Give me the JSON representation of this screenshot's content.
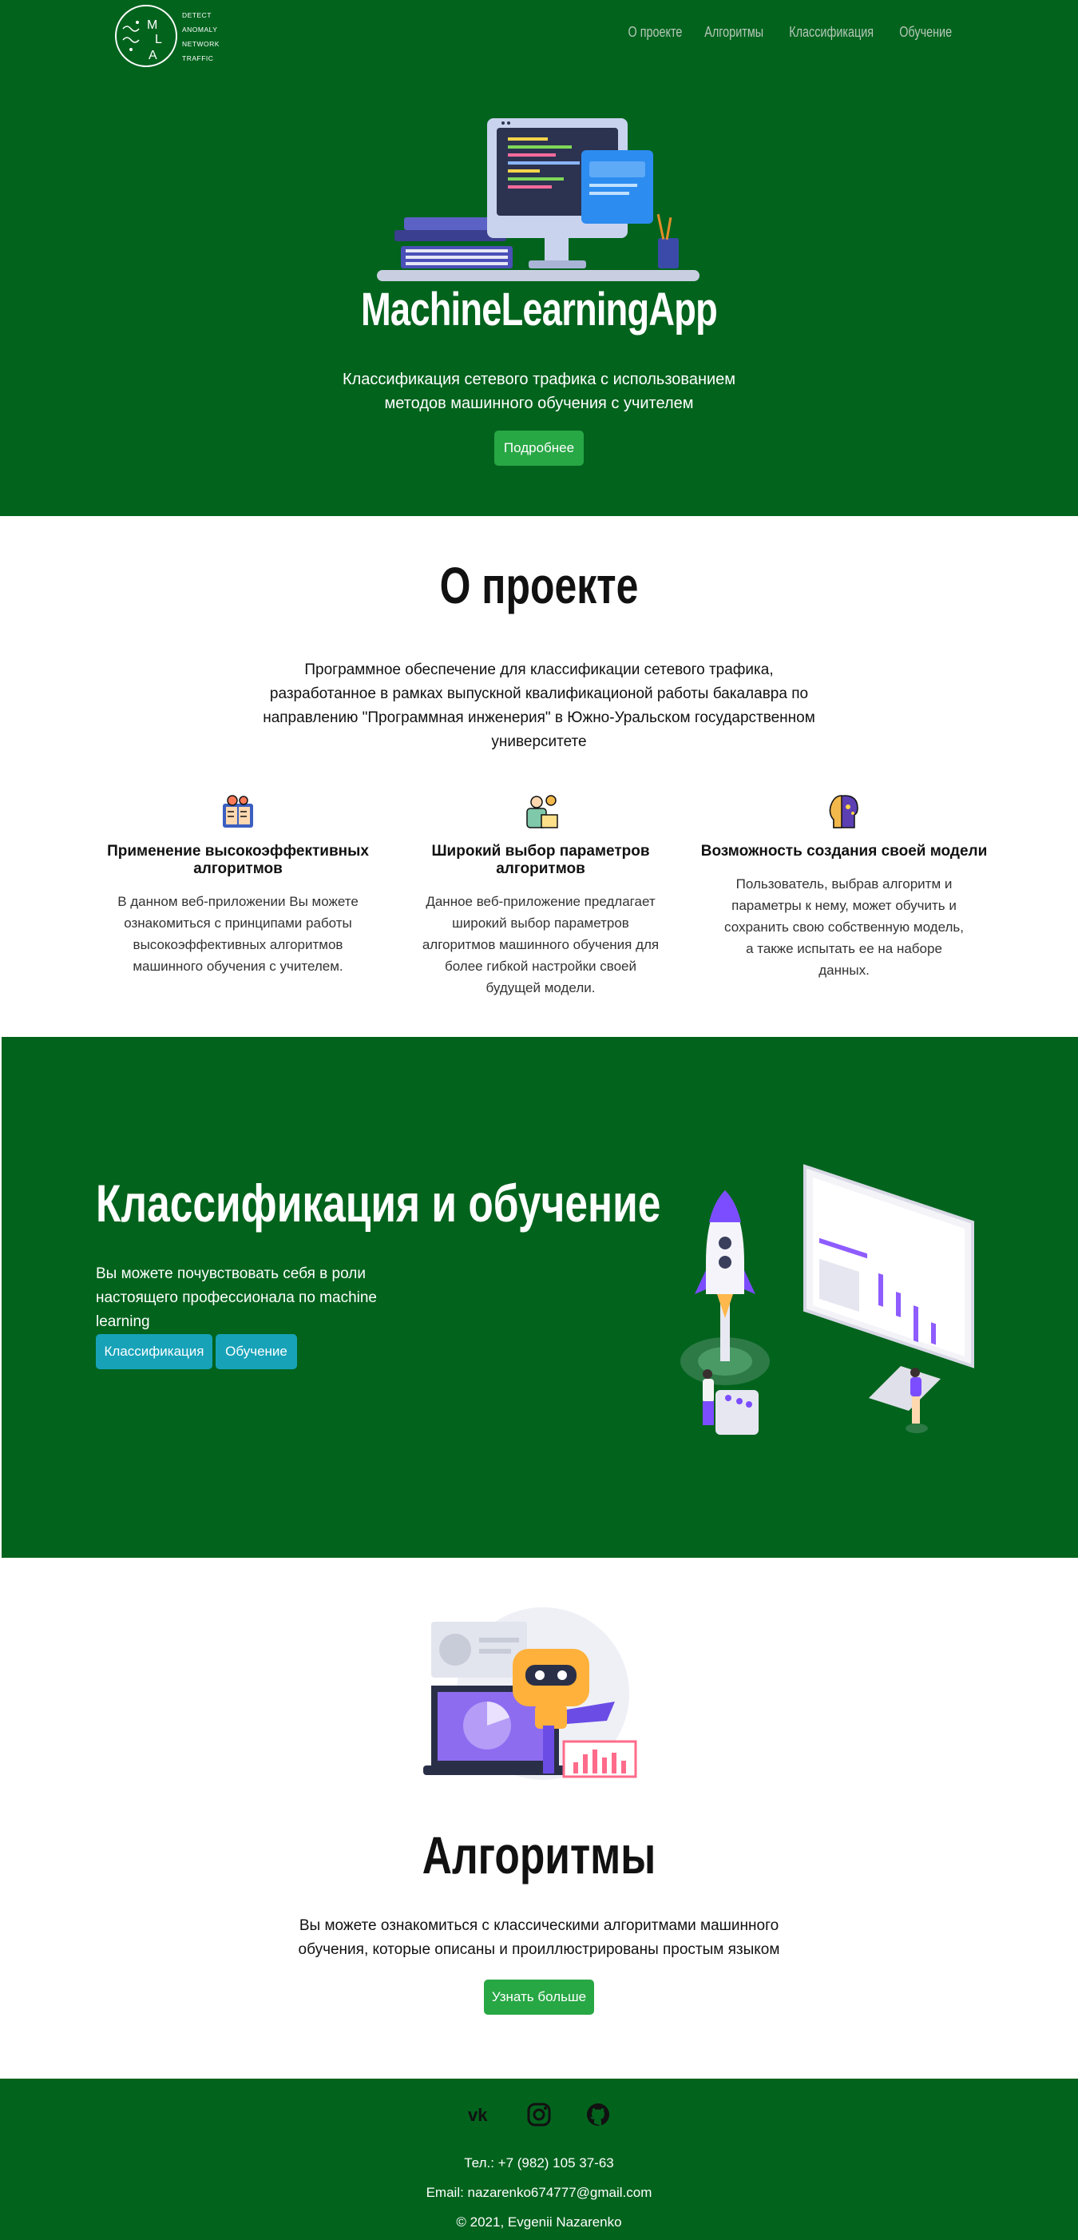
{
  "logo": {
    "letters": [
      "M",
      "L",
      "A"
    ],
    "words": [
      "DETECT",
      "ANOMALY",
      "NETWORK",
      "TRAFFIC"
    ]
  },
  "nav": {
    "items": [
      "О проекте",
      "Алгоритмы",
      "Классификация",
      "Обучение"
    ]
  },
  "hero": {
    "title": "MachineLearningApp",
    "subtitle": "Классификация сетевого трафика с использованием методов машинного обучения с учителем",
    "button": "Подробнее"
  },
  "about": {
    "title": "О проекте",
    "text": "Программное обеспечение для классификации сетевого трафика, разработанное в рамках выпускной квалификационой работы бакалавра по направлению \"Программная инженерия\" в Южно-Уральском государственном университете",
    "features": [
      {
        "icon": "book-gears-icon",
        "title": "Применение высокоэффективных алгоритмов",
        "text": "В данном веб-приложении Вы можете ознакомиться с принципами работы высокоэффективных алгоритмов машинного обучения с учителем."
      },
      {
        "icon": "person-settings-icon",
        "title": "Широкий выбор параметров алгоритмов",
        "text": "Данное веб-приложение предлагает широкий выбор параметров алгоритмов машинного обучения для более гибкой настройки своей будущей модели."
      },
      {
        "icon": "head-brain-icon",
        "title": "Возможность создания своей модели",
        "text": "Пользователь, выбрав алгоритм и параметры к нему, может обучить и сохранить свою собственную модель, а также испытать ее на наборе данных."
      }
    ]
  },
  "classify": {
    "title": "Классификация и обучение",
    "text": "Вы можете почувствовать себя в роли настоящего профессионала по machine learning",
    "buttons": [
      "Классификация",
      "Обучение"
    ]
  },
  "algorithms": {
    "title": "Алгоритмы",
    "text": "Вы можете ознакомиться с классическими алгоритмами машинного обучения, которые описаны и проиллюстрированы простым языком",
    "button": "Узнать больше"
  },
  "footer": {
    "social": [
      "vk-icon",
      "instagram-icon",
      "github-icon"
    ],
    "phone": "Тел.: +7 (982) 105 37-63",
    "email": "Email: nazarenko674777@gmail.com",
    "copyright": "© 2021, Evgenii Nazarenko"
  },
  "colors": {
    "green_bg": "#02631d",
    "success_button": "#28a745",
    "info_button": "#17a2b8"
  }
}
